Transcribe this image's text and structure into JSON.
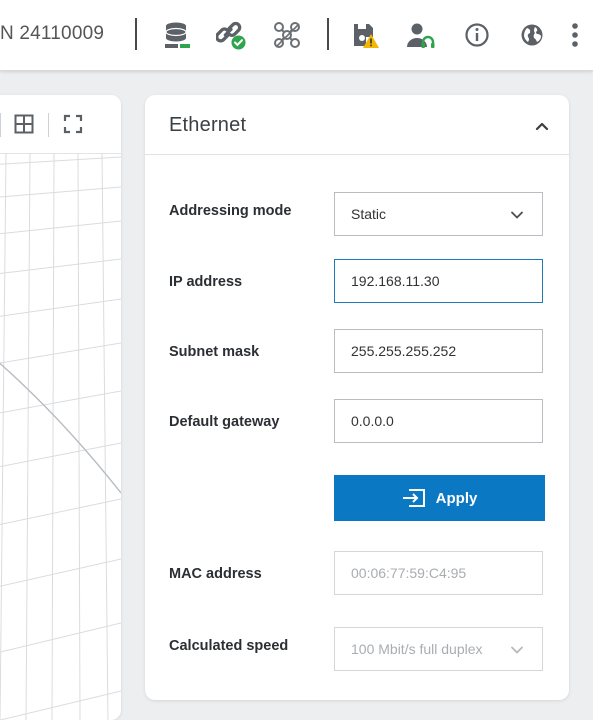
{
  "toolbar": {
    "device_id": "N 24110009",
    "icons": [
      {
        "name": "database-status-icon",
        "color": "#2ea44f"
      },
      {
        "name": "link-connected-icon",
        "color": "#2ea44f"
      },
      {
        "name": "network-nodes-icon"
      },
      {
        "name": "save-warning-icon",
        "color": "#f2b705"
      },
      {
        "name": "user-headset-icon",
        "color": "#2ea44f"
      },
      {
        "name": "info-icon"
      },
      {
        "name": "globe-icon"
      },
      {
        "name": "more-vertical-icon"
      }
    ]
  },
  "view": {
    "icons": [
      "grid-layout-icon",
      "fullscreen-icon"
    ]
  },
  "ethernet": {
    "title": "Ethernet",
    "addressing_mode_label": "Addressing mode",
    "addressing_mode_value": "Static",
    "ip_label": "IP address",
    "ip_value": "192.168.11.30",
    "subnet_label": "Subnet mask",
    "subnet_value": "255.255.255.252",
    "gateway_label": "Default gateway",
    "gateway_value": "0.0.0.0",
    "apply_label": "Apply",
    "mac_label": "MAC address",
    "mac_value": "00:06:77:59:C4:95",
    "speed_label": "Calculated speed",
    "speed_value": "100 Mbit/s full duplex"
  },
  "colors": {
    "accent": "#0a78c2",
    "status_ok": "#2ea44f",
    "status_warning": "#f2b705"
  }
}
